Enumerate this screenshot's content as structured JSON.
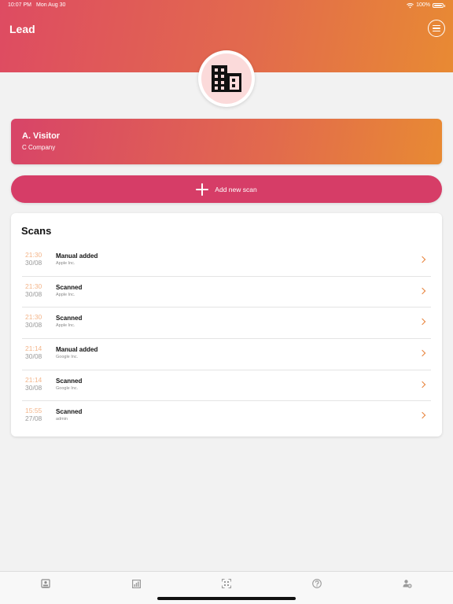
{
  "status_bar": {
    "time": "10:07 PM",
    "date": "Mon Aug 30",
    "battery": "100%"
  },
  "header": {
    "title": "Lead"
  },
  "icons": {
    "menu": "menu-icon",
    "avatar": "building-icon",
    "add": "plus-icon",
    "row": "chevron-right-icon",
    "tabs": [
      "contact-card-icon",
      "chart-icon",
      "scan-icon",
      "help-icon",
      "user-settings-icon"
    ]
  },
  "visitor": {
    "name": "A. Visitor",
    "company": "C Company"
  },
  "add_scan": {
    "label": "Add new scan"
  },
  "scans": {
    "title": "Scans",
    "items": [
      {
        "time": "21:30",
        "date": "30/08",
        "type": "Manual added",
        "company": "Apple Inc."
      },
      {
        "time": "21:30",
        "date": "30/08",
        "type": "Scanned",
        "company": "Apple Inc."
      },
      {
        "time": "21:30",
        "date": "30/08",
        "type": "Scanned",
        "company": "Apple Inc."
      },
      {
        "time": "21:14",
        "date": "30/08",
        "type": "Manual added",
        "company": "Google Inc."
      },
      {
        "time": "21:14",
        "date": "30/08",
        "type": "Scanned",
        "company": "Google Inc."
      },
      {
        "time": "15:55",
        "date": "27/08",
        "type": "Scanned",
        "company": "admin"
      }
    ]
  },
  "colors": {
    "accent": "#d63d67",
    "gradient_start": "#de4b62",
    "gradient_end": "#e88a33",
    "chevron": "#e8823a",
    "time_text": "#f3b58a"
  }
}
